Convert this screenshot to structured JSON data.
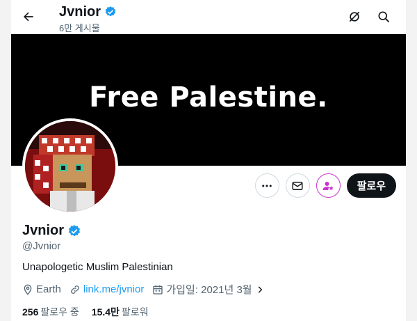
{
  "header": {
    "title": "Jvnior",
    "post_count": "6만 게시물",
    "back_icon": "arrow-left-icon",
    "right_icons": [
      "grok-icon",
      "search-icon"
    ]
  },
  "banner": {
    "text": "Free Palestine."
  },
  "actions": {
    "more_icon": "more-dots-icon",
    "message_icon": "envelope-icon",
    "subscribe_icon": "person-star-icon",
    "follow_label": "팔로우"
  },
  "profile": {
    "name": "Jvnior",
    "handle": "@Jvnior",
    "bio": "Unapologetic Muslim Palestinian",
    "location": "Earth",
    "link": "link.me/jvnior",
    "joined": "가입일: 2021년 3월"
  },
  "stats": {
    "following_count": "256",
    "following_label": "팔로우 중",
    "followers_count": "15.4만",
    "followers_label": "팔로워"
  },
  "colors": {
    "accent": "#1d9bf0",
    "verified": "#1d9bf0",
    "subscribe": "#c936cc",
    "text": "#0f1419",
    "muted": "#536471"
  }
}
